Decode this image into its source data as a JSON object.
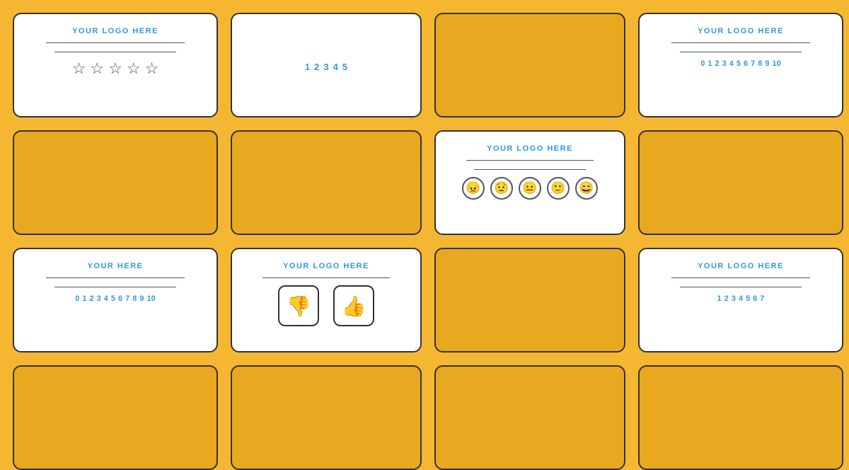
{
  "background_color": "#F5B731",
  "cards": {
    "logo_text": "YOUR LOGO HERE",
    "logo_text_bottom": "YouR HeRE",
    "divider": "—",
    "numbers_1_5": "1  2  3  4  5",
    "numbers_0_10": "0  1  2  3  4  5  6  7  8  9  10",
    "numbers_0_10_partial": "0  1  2  3  4  5  6  7",
    "stars_label": "★★★★★",
    "emoji_label": "😡 😟 😐 🙂 😁",
    "thumbs_up": "👍",
    "thumbs_down": "👎"
  },
  "colors": {
    "accent_blue": "#3399DD",
    "card_yellow": "#E8A820",
    "text_dark": "#333333",
    "background": "#F5B731"
  }
}
